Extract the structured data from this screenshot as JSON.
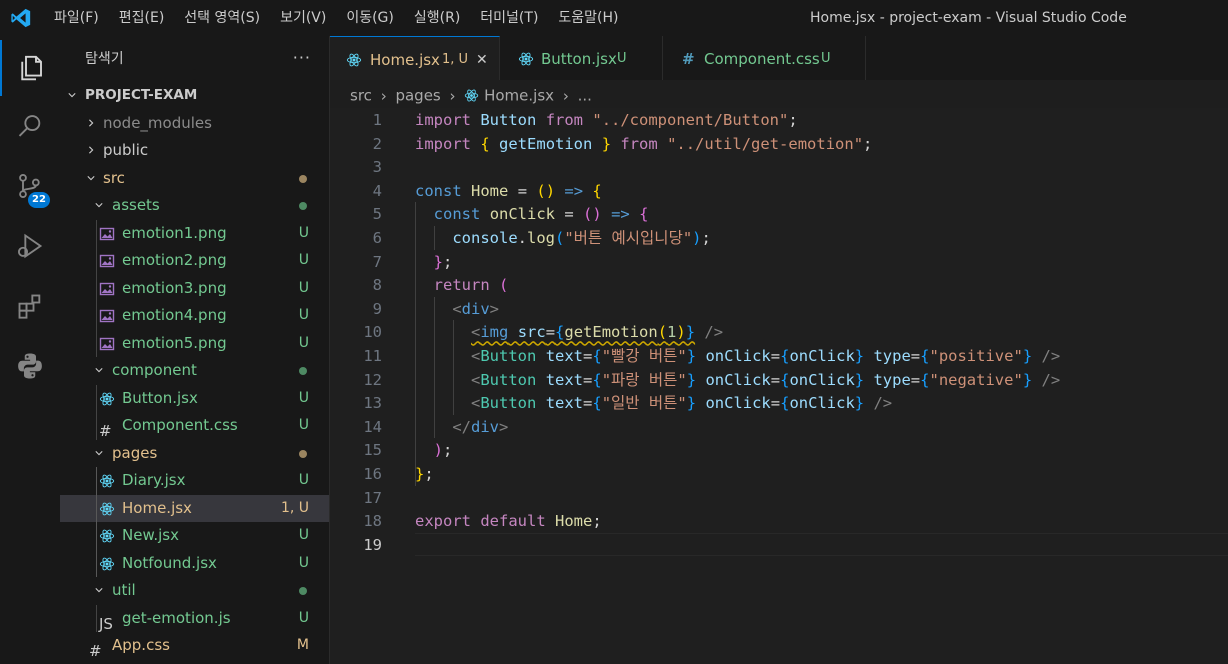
{
  "menu": [
    "파일(F)",
    "편집(E)",
    "선택 영역(S)",
    "보기(V)",
    "이동(G)",
    "실행(R)",
    "터미널(T)",
    "도움말(H)"
  ],
  "window_title": "Home.jsx - project-exam - Visual Studio Code",
  "activity": {
    "scm_badge": "22"
  },
  "explorer": {
    "title": "탐색기",
    "more": "···",
    "tree": [
      {
        "label": "PROJECT-EXAM",
        "kind": "root",
        "deco": ""
      },
      {
        "label": "node_modules",
        "kind": "folder-closed",
        "deco": ""
      },
      {
        "label": "public",
        "kind": "folder-closed",
        "deco": ""
      },
      {
        "label": "src",
        "kind": "folder-open",
        "deco": "dot-modified"
      },
      {
        "label": "assets",
        "kind": "folder-open",
        "deco": "dot-untracked"
      },
      {
        "label": "emotion1.png",
        "kind": "png",
        "deco": "U"
      },
      {
        "label": "emotion2.png",
        "kind": "png",
        "deco": "U"
      },
      {
        "label": "emotion3.png",
        "kind": "png",
        "deco": "U"
      },
      {
        "label": "emotion4.png",
        "kind": "png",
        "deco": "U"
      },
      {
        "label": "emotion5.png",
        "kind": "png",
        "deco": "U"
      },
      {
        "label": "component",
        "kind": "folder-open",
        "deco": "dot-untracked"
      },
      {
        "label": "Button.jsx",
        "kind": "react",
        "deco": "U"
      },
      {
        "label": "Component.css",
        "kind": "css",
        "deco": "U"
      },
      {
        "label": "pages",
        "kind": "folder-open",
        "deco": "dot-modified"
      },
      {
        "label": "Diary.jsx",
        "kind": "react",
        "deco": "U"
      },
      {
        "label": "Home.jsx",
        "kind": "react",
        "deco": "1, U"
      },
      {
        "label": "New.jsx",
        "kind": "react",
        "deco": "U"
      },
      {
        "label": "Notfound.jsx",
        "kind": "react",
        "deco": "U"
      },
      {
        "label": "util",
        "kind": "folder-open",
        "deco": "dot-untracked"
      },
      {
        "label": "get-emotion.js",
        "kind": "js",
        "deco": "U"
      },
      {
        "label": "App.css",
        "kind": "css",
        "deco": "M"
      }
    ]
  },
  "tabs": [
    {
      "label": "Home.jsx",
      "status": "1, U",
      "close": "✕"
    },
    {
      "label": "Button.jsx",
      "status": "U"
    },
    {
      "label": "Component.css",
      "status": "U"
    }
  ],
  "breadcrumb": [
    "src",
    "pages",
    "Home.jsx",
    "..."
  ],
  "editor": {
    "current_line": "19",
    "lines": [
      "import Button from \"../component/Button\";",
      "import { getEmotion } from \"../util/get-emotion\";",
      "",
      "const Home = () => {",
      "  const onClick = () => {",
      "    console.log(\"버튼 예시입니당\");",
      "  };",
      "  return (",
      "    <div>",
      "      <img src={getEmotion(1)} />",
      "      <Button text={\"빨강 버튼\"} onClick={onClick} type={\"positive\"} />",
      "      <Button text={\"파랑 버튼\"} onClick={onClick} type={\"negative\"} />",
      "      <Button text={\"일반 버튼\"} onClick={onClick} />",
      "    </div>",
      "  );",
      "};",
      "",
      "export default Home;",
      ""
    ]
  },
  "colors": {
    "accent": "#0078d4",
    "untracked": "#73c991",
    "modified": "#e2c08d",
    "selected_row": "#37373d"
  }
}
